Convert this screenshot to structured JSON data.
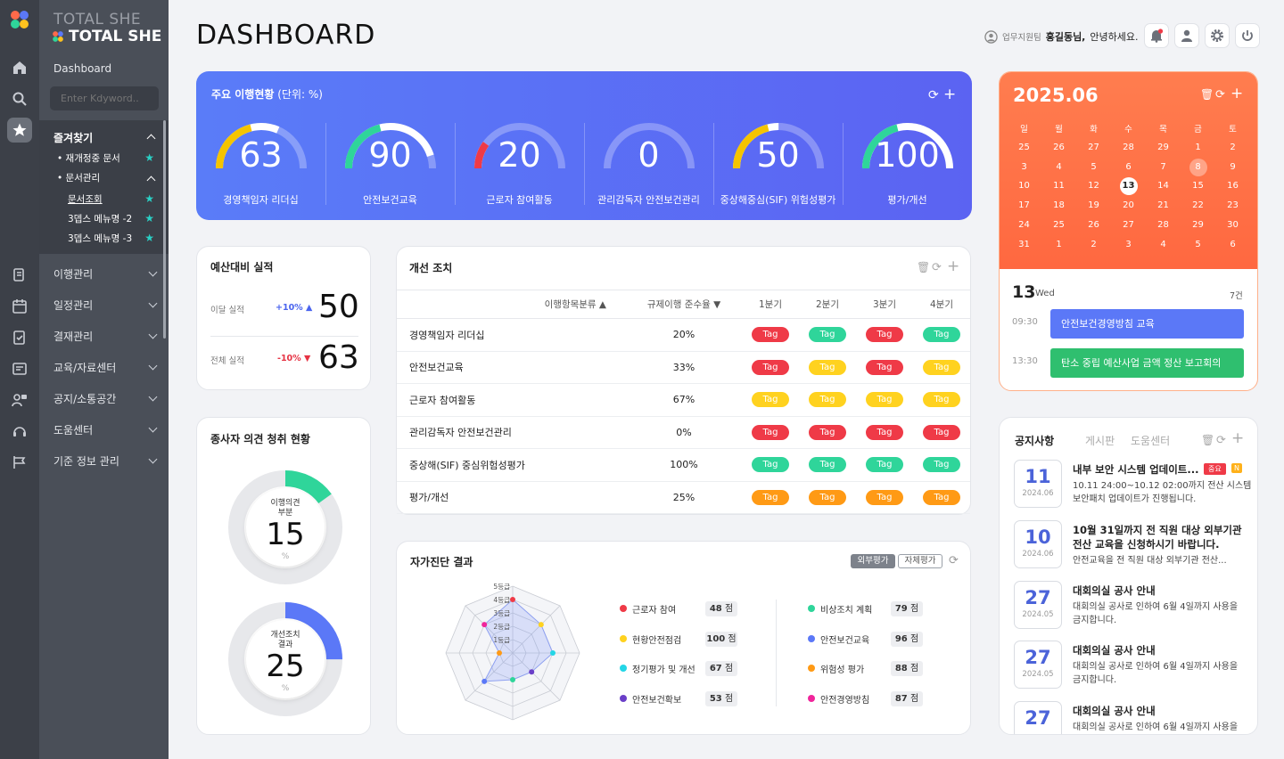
{
  "brand": {
    "title_ghost": "TOTAL SHE",
    "title": "TOTAL SHE"
  },
  "sidebar": {
    "dashboard": "Dashboard",
    "search_placeholder": "Enter Kdyword..",
    "favorites": "즐겨찾기",
    "fav_items": [
      {
        "label": "재개정중 문서"
      },
      {
        "label": "문서관리"
      },
      {
        "label": "문서조회"
      },
      {
        "label": "3뎁스 메뉴명 -2"
      },
      {
        "label": "3뎁스 메뉴명 -3"
      }
    ],
    "menus": [
      "이행관리",
      "일정관리",
      "결재관리",
      "교육/자료센터",
      "공지/소통공간",
      "도움센터",
      "기준 정보 관리"
    ]
  },
  "header": {
    "title": "DASHBOARD",
    "dept": "업무지원팀",
    "user": "홍길동님,",
    "greeting": "안녕하세요."
  },
  "kpi": {
    "title": "주요 이행현황",
    "unit": "(단위: %)",
    "gauges": [
      {
        "value": "63",
        "label": "경영책임자 리더십",
        "color": "#f5c400"
      },
      {
        "value": "90",
        "label": "안전보건교육",
        "color": "#2fd59a"
      },
      {
        "value": "20",
        "label": "근로자 참여활동",
        "color": "#ef3a47"
      },
      {
        "value": "0",
        "label": "관리감독자 안전보건관리",
        "color": "#ef3a47"
      },
      {
        "value": "50",
        "label": "중상해중심(SIF) 위험성평가",
        "color": "#f5c400"
      },
      {
        "value": "100",
        "label": "평가/개선",
        "color": "#2fd59a"
      }
    ]
  },
  "budget": {
    "title": "예산대비 실적",
    "rows": [
      {
        "label": "이달 실적",
        "change": "+10%",
        "arrow": "▲",
        "value": "50"
      },
      {
        "label": "전체 실적",
        "change": "-10%",
        "arrow": "▼",
        "value": "63"
      }
    ]
  },
  "opinion": {
    "title": "종사자 의견 청취 현황",
    "donuts": [
      {
        "label1": "이행의견",
        "label2": "부분",
        "value": "15",
        "unit": "%",
        "percent": 15,
        "color": "#2fd59a"
      },
      {
        "label1": "개선조치",
        "label2": "결과",
        "value": "25",
        "unit": "%",
        "percent": 25,
        "color": "#5b78f7"
      }
    ]
  },
  "improve": {
    "title": "개선 조치",
    "headers": [
      "이행항목분류 ▲",
      "규제이행 준수율 ▼",
      "1분기",
      "2분기",
      "3분기",
      "4분기"
    ],
    "tag_text": "Tag",
    "rows": [
      {
        "name": "경영책임자 리더십",
        "rate": "20%",
        "tags": [
          "red",
          "green",
          "red",
          "green"
        ]
      },
      {
        "name": "안전보건교육",
        "rate": "33%",
        "tags": [
          "red",
          "yellow",
          "red",
          "yellow"
        ]
      },
      {
        "name": "근로자 참여활동",
        "rate": "67%",
        "tags": [
          "yellow",
          "yellow",
          "yellow",
          "yellow"
        ]
      },
      {
        "name": "관리감독자 안전보건관리",
        "rate": "0%",
        "tags": [
          "red",
          "red",
          "red",
          "red"
        ]
      },
      {
        "name": "중상해(SIF) 중심위험성평가",
        "rate": "100%",
        "tags": [
          "green",
          "green",
          "green",
          "green"
        ]
      },
      {
        "name": "평가/개선",
        "rate": "25%",
        "tags": [
          "orange",
          "orange",
          "orange",
          "orange"
        ]
      }
    ]
  },
  "selfcheck": {
    "title": "자가진단 결과",
    "tab_active": "외부평가",
    "tab_inactive": "자체평가",
    "grades": [
      "5등급",
      "4등급",
      "3등급",
      "2등급",
      "1등급"
    ],
    "items": [
      {
        "name": "근로자 참여",
        "score": "48",
        "unit": "점",
        "color": "#ef3a47",
        "grade": 4
      },
      {
        "name": "현황안전점검",
        "score": "100",
        "unit": "점",
        "color": "#ffd21f",
        "grade": 3
      },
      {
        "name": "정기평가 및 개선",
        "score": "67",
        "unit": "점",
        "color": "#24d6e6",
        "grade": 3
      },
      {
        "name": "안전보건확보",
        "score": "53",
        "unit": "점",
        "color": "#6a3fc8",
        "grade": 2
      },
      {
        "name": "비상조치 계획",
        "score": "79",
        "unit": "점",
        "color": "#2fd59a",
        "grade": 2
      },
      {
        "name": "안전보건교육",
        "score": "96",
        "unit": "점",
        "color": "#5b78f7",
        "grade": 3
      },
      {
        "name": "위험성 평가",
        "score": "88",
        "unit": "점",
        "color": "#ff9a15",
        "grade": 1
      },
      {
        "name": "안전경영방침",
        "score": "87",
        "unit": "점",
        "color": "#f0259b",
        "grade": 3
      }
    ]
  },
  "calendar": {
    "month": "2025.06",
    "weekdays": [
      "일",
      "월",
      "화",
      "수",
      "목",
      "금",
      "토"
    ],
    "weeks": [
      [
        "25",
        "26",
        "27",
        "28",
        "29",
        "1",
        "2"
      ],
      [
        "3",
        "4",
        "5",
        "6",
        "7",
        "8",
        "9"
      ],
      [
        "10",
        "11",
        "12",
        "13",
        "14",
        "15",
        "16"
      ],
      [
        "17",
        "18",
        "19",
        "20",
        "21",
        "22",
        "23"
      ],
      [
        "24",
        "25",
        "26",
        "27",
        "28",
        "29",
        "30"
      ],
      [
        "31",
        "1",
        "2",
        "3",
        "4",
        "5",
        "6"
      ]
    ],
    "today": "13",
    "selected": "8",
    "day": "13",
    "weekday": "Wed",
    "count": "7건",
    "events": [
      {
        "time": "09:30",
        "title": "안전보건경영방침 교육",
        "color": "#5b78f7"
      },
      {
        "time": "13:30",
        "title": "탄소 중립 예산사업 금액 정산 보고회의",
        "color": "#2fbf6f"
      }
    ]
  },
  "notice": {
    "tabs": [
      "공지사항",
      "게시판",
      "도움센터"
    ],
    "items": [
      {
        "day": "11",
        "ym": "2024.06",
        "title": "내부 보안 시스템 업데이트...",
        "badge": "중요",
        "new": "N",
        "body1": "10.11 24:00~10.12 02:00까지 전산 시스템",
        "body2": "보안패치 업데이트가 진행됩니다."
      },
      {
        "day": "10",
        "ym": "2024.06",
        "title": "10월 31일까지 전 직원 대상 외부기관",
        "title2": "전산 교육을 신청하시기 바랍니다.",
        "body1": "안전교육을 전 직원 대상 외부기관 전산..."
      },
      {
        "day": "27",
        "ym": "2024.05",
        "title": "대회의실 공사 안내",
        "body1": "대회의실 공사로 인하여 6월 4일까지 사용을",
        "body2": "금지합니다."
      },
      {
        "day": "27",
        "ym": "2024.05",
        "title": "대회의실 공사 안내",
        "body1": "대회의실 공사로 인하여 6월 4일까지 사용을",
        "body2": "금지합니다."
      },
      {
        "day": "27",
        "ym": "",
        "title": "대회의실 공사 안내",
        "body1": "대회의실 공사로 인하여 6월 4일까지 사용을"
      }
    ]
  }
}
